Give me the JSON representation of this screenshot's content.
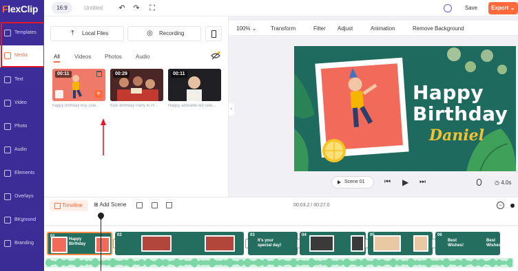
{
  "app": {
    "logo_prefix": "F",
    "logo_rest": "lexClip"
  },
  "topbar": {
    "aspect_ratio": "16:9",
    "project_name": "Untitled",
    "save_label": "Save",
    "export_label": "Export",
    "export_caret": "⌄"
  },
  "sidebar": {
    "items": [
      {
        "label": "Templates",
        "icon": "templates-icon"
      },
      {
        "label": "Media",
        "icon": "media-icon"
      },
      {
        "label": "Text",
        "icon": "text-icon"
      },
      {
        "label": "Video",
        "icon": "video-icon"
      },
      {
        "label": "Photo",
        "icon": "photo-icon"
      },
      {
        "label": "Audio",
        "icon": "audio-icon"
      },
      {
        "label": "Elements",
        "icon": "elements-icon"
      },
      {
        "label": "Overlays",
        "icon": "overlays-icon"
      },
      {
        "label": "BKground",
        "icon": "background-icon"
      },
      {
        "label": "Branding",
        "icon": "branding-icon"
      }
    ],
    "active": "Media"
  },
  "media_panel": {
    "local_files_label": "Local Files",
    "recording_label": "Recording",
    "filters": [
      "All",
      "Videos",
      "Photos",
      "Audio"
    ],
    "active_filter": "All",
    "items": [
      {
        "duration": "00:11",
        "caption": "happy birthday boy cele..."
      },
      {
        "duration": "00:29",
        "caption": "Kids Birthday Party in Pl..."
      },
      {
        "duration": "00:11",
        "caption": "Happy adorable kid cele..."
      }
    ]
  },
  "preview": {
    "zoom": "100%",
    "tools": [
      "Transform",
      "Filter",
      "Adjust",
      "Animation",
      "Remove Background"
    ],
    "canvas_text": {
      "line1": "Happy",
      "line2": "Birthday",
      "name": "Daniel"
    },
    "scene_label": "Scene 01",
    "duration": "4.0s"
  },
  "timeline": {
    "label": "Timeline",
    "add_scene": "Add Scene",
    "time": "00:03.2 / 00:27.0",
    "clips": [
      {
        "num": "01",
        "text": "Happy Birthday"
      },
      {
        "num": "02",
        "text": ""
      },
      {
        "num": "03",
        "text": "It's your special day!"
      },
      {
        "num": "04",
        "text": ""
      },
      {
        "num": "05",
        "text": ""
      },
      {
        "num": "06",
        "text": "Best Wishes!"
      }
    ]
  },
  "colors": {
    "accent": "#ff6a3d",
    "nav_bg": "#3d2d9a",
    "canvas_bg": "#1f6a5e",
    "highlight": "#e3192a"
  }
}
